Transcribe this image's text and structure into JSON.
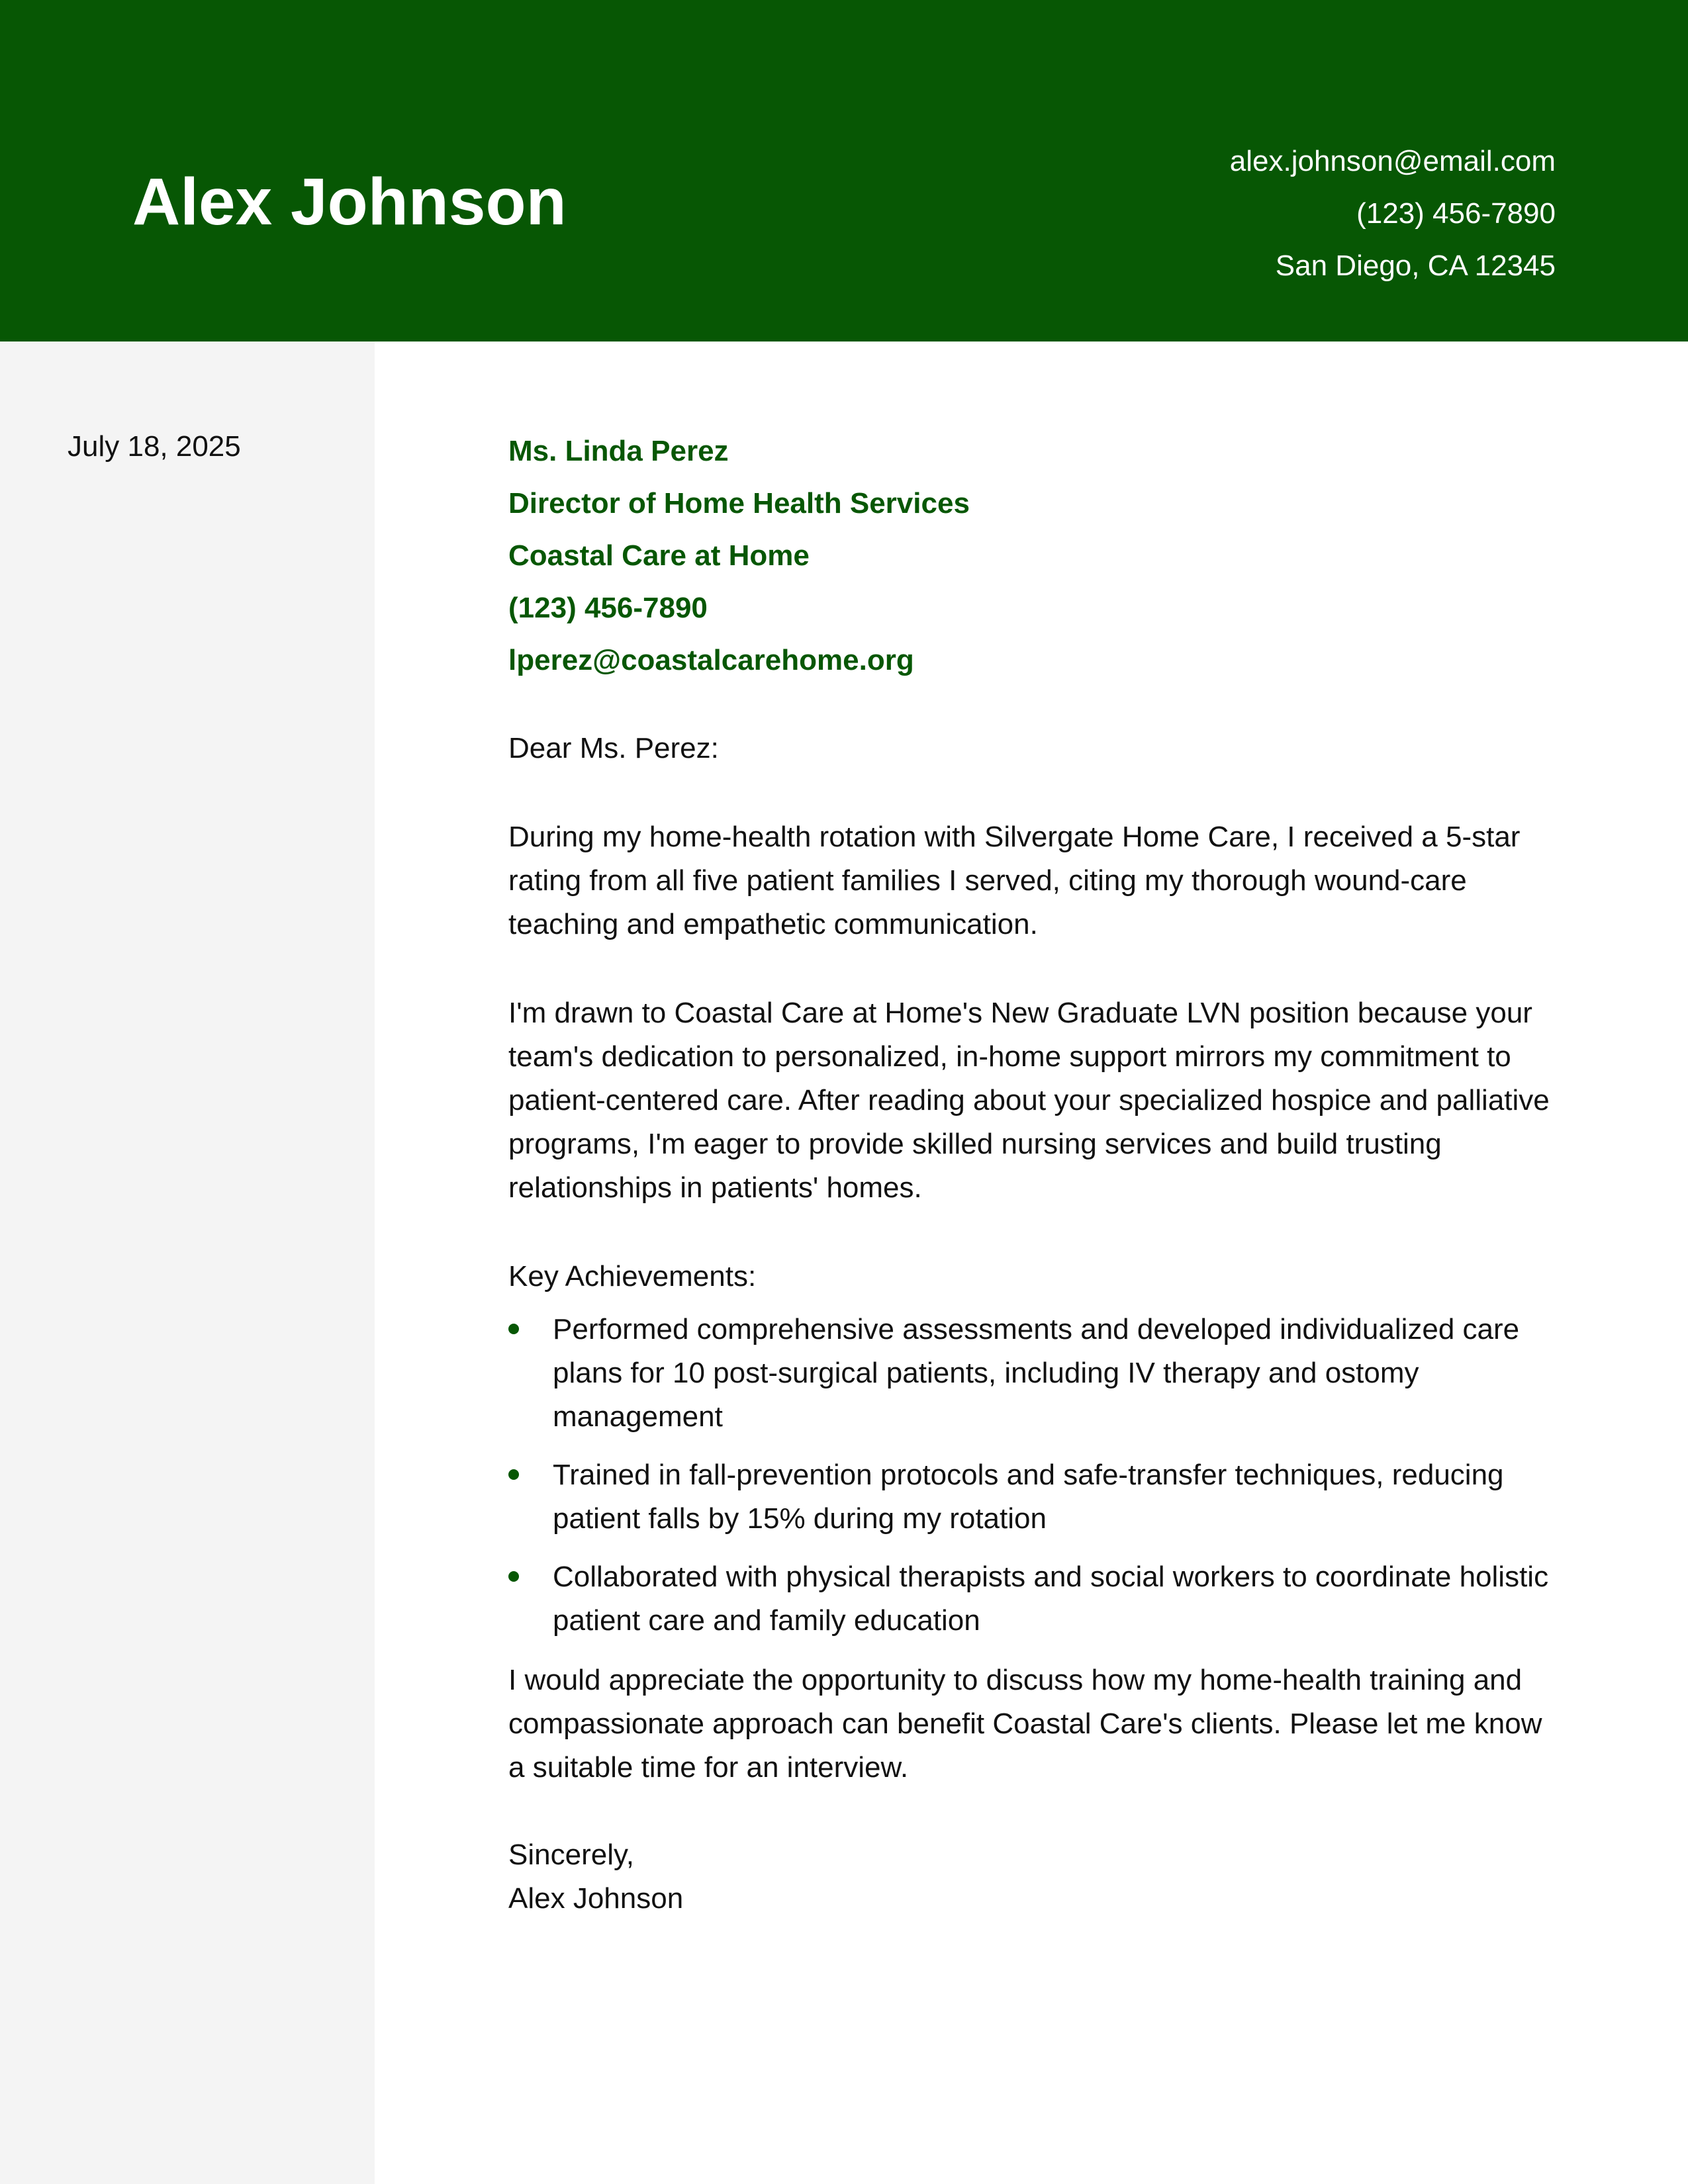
{
  "header": {
    "name": "Alex Johnson",
    "email": "alex.johnson@email.com",
    "phone": "(123) 456-7890",
    "location": "San Diego, CA 12345"
  },
  "sidebar": {
    "date": "July 18, 2025"
  },
  "recipient": {
    "name": "Ms. Linda Perez",
    "title": "Director of Home Health Services",
    "company": "Coastal Care at Home",
    "phone": "(123) 456-7890",
    "email": "lperez@coastalcarehome.org"
  },
  "letter": {
    "salutation": "Dear Ms. Perez:",
    "paragraph1": "During my home-health rotation with Silvergate Home Care, I received a 5-star rating from all five patient families I served, citing my thorough wound-care teaching and empathetic communication.",
    "paragraph2": "I'm drawn to Coastal Care at Home's New Graduate LVN position because your team's dedication to personalized, in-home support mirrors my commitment to patient-centered care. After reading about your specialized hospice and palliative programs, I'm eager to provide skilled nursing services and build trusting relationships in patients' homes.",
    "achievements_heading": "Key Achievements:",
    "achievements": [
      "Performed comprehensive assessments and developed individualized care plans for 10 post-surgical patients, including IV therapy and ostomy management",
      "Trained in fall-prevention protocols and safe-transfer techniques, reducing patient falls by 15% during my rotation",
      "Collaborated with physical therapists and social workers to coordinate holistic patient care and family education"
    ],
    "closing_paragraph": "I would appreciate the opportunity to discuss how my home-health training and compassionate approach can benefit Coastal Care's clients. Please let me know a suitable time for an interview.",
    "signoff": "Sincerely,",
    "signature_name": "Alex Johnson"
  },
  "colors": {
    "accent": "#075704",
    "sidebar_bg": "#f4f4f4",
    "text": "#111111"
  }
}
